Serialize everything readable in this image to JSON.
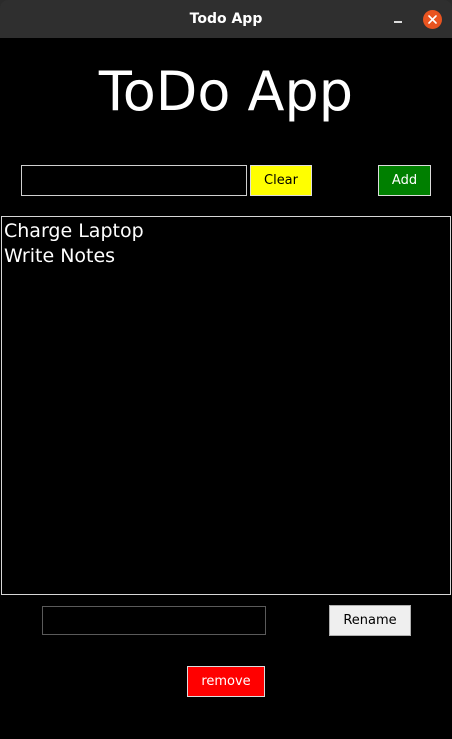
{
  "window": {
    "title": "Todo App",
    "close_icon": "close-icon",
    "minimize_icon": "minimize-icon"
  },
  "app": {
    "heading": "ToDo App",
    "task_input": {
      "value": "",
      "placeholder": ""
    },
    "clear_label": "Clear",
    "add_label": "Add",
    "tasks": [
      "Charge Laptop",
      "Write Notes"
    ],
    "rename_input": {
      "value": "",
      "placeholder": ""
    },
    "rename_label": "Rename",
    "remove_label": "remove"
  },
  "colors": {
    "background": "#000000",
    "clear_button": "#ffff00",
    "add_button": "#007f00",
    "remove_button": "#ff0000",
    "rename_button": "#efefef",
    "close_button": "#e95420"
  }
}
